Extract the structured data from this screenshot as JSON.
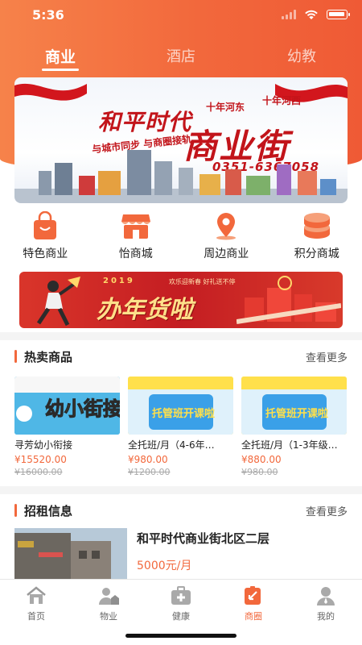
{
  "status_bar": {
    "time": "5:36"
  },
  "top_tabs": [
    {
      "label": "商业",
      "active": true
    },
    {
      "label": "酒店",
      "active": false
    },
    {
      "label": "幼教",
      "active": false
    }
  ],
  "banner": {
    "title_top": "和平时代",
    "tag1": "十年河东",
    "tag2": "十年河西",
    "title_main": "商业街",
    "subtitle": "与城市同步 与商圈接轨",
    "phone": "0351-6367058"
  },
  "categories": [
    {
      "label": "特色商业",
      "icon": "shopping-bag-icon",
      "color": "#f2683c"
    },
    {
      "label": "怡商城",
      "icon": "storefront-icon",
      "color": "#f2683c"
    },
    {
      "label": "周边商业",
      "icon": "location-pin-icon",
      "color": "#f2683c"
    },
    {
      "label": "积分商城",
      "icon": "coin-stack-icon",
      "color": "#f2683c"
    }
  ],
  "promo": {
    "year": "2019",
    "slogan": "欢乐迎新春 好礼送不停",
    "title": "办年货啦"
  },
  "hot_section": {
    "title": "热卖商品",
    "more": "查看更多"
  },
  "products": [
    {
      "image_text": "幼小街接班",
      "name": "寻芳幼小衔接",
      "price": "¥15520.00",
      "old_price": "¥16000.00"
    },
    {
      "image_text": "托管班开课啦",
      "name": "全托班/月（4-6年…",
      "price": "¥980.00",
      "old_price": "¥1200.00"
    },
    {
      "image_text": "托管班开课啦",
      "name": "全托班/月（1-3年级…",
      "price": "¥880.00",
      "old_price": "¥980.00"
    }
  ],
  "rental_section": {
    "title": "招租信息",
    "more": "查看更多"
  },
  "rental": {
    "title": "和平时代商业街北区二层",
    "price": "5000元/月"
  },
  "bottom_nav": [
    {
      "label": "首页",
      "icon": "home-icon",
      "active": false
    },
    {
      "label": "物业",
      "icon": "property-person-icon",
      "active": false
    },
    {
      "label": "健康",
      "icon": "medical-kit-icon",
      "active": false
    },
    {
      "label": "商圈",
      "icon": "business-district-icon",
      "active": true
    },
    {
      "label": "我的",
      "icon": "user-profile-icon",
      "active": false
    }
  ],
  "colors": {
    "accent": "#f2683c",
    "header": "#f6824a",
    "banner_red": "#c2141a"
  }
}
